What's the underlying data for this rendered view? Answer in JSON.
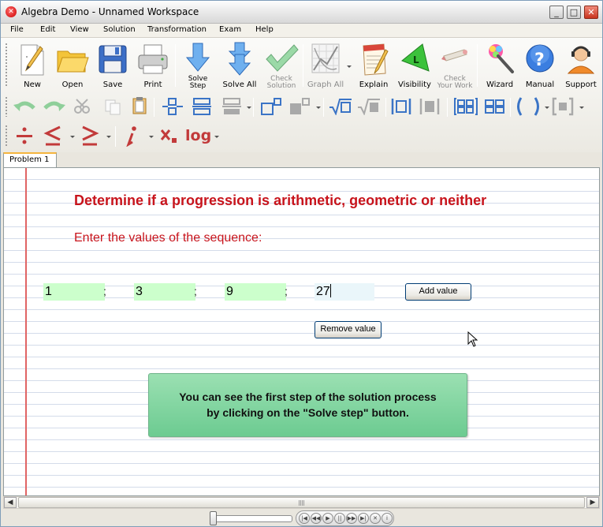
{
  "window": {
    "title": "Algebra Demo - Unnamed Workspace"
  },
  "menu": [
    "File",
    "Edit",
    "View",
    "Solution",
    "Transformation",
    "Exam",
    "Help"
  ],
  "toolbar_main": {
    "new": "New",
    "open": "Open",
    "save": "Save",
    "print": "Print",
    "solve_step": [
      "Solve",
      "Step"
    ],
    "solve_all": "Solve All",
    "check_solution": [
      "Check",
      "Solution"
    ],
    "graph_all": "Graph All",
    "explain": "Explain",
    "visibility": "Visibility",
    "check_your_work": [
      "Check",
      "Your Work"
    ],
    "wizard": "Wizard",
    "manual": "Manual",
    "support": "Support"
  },
  "toolbar_math": {
    "log": "log"
  },
  "tabs": [
    "Problem 1"
  ],
  "problem": {
    "heading": "Determine if a progression is arithmetic, geometric or neither",
    "prompt": "Enter the values of the sequence:",
    "values": [
      "1",
      "3",
      "9",
      "27"
    ],
    "separator": ";",
    "add_value": "Add value",
    "remove_value": "Remove value",
    "hint_lines": [
      "You can see the first step of the solution process",
      "by clicking on the \"Solve step\" button."
    ]
  },
  "colors": {
    "heading": "#c8141c",
    "field_green": "#ccffcc",
    "field_active": "#eaf6fa",
    "hint_green": "#6ccb91",
    "margin_line": "#e06464"
  },
  "icons": {
    "new": "new-document-icon",
    "open": "folder-icon",
    "save": "floppy-icon",
    "print": "printer-icon",
    "solve_step": "down-arrow-icon",
    "solve_all": "double-down-arrow-icon",
    "check_solution": "checkmark-icon",
    "graph_all": "graph-icon",
    "explain": "notepad-icon",
    "visibility": "visibility-triangle-icon",
    "check_your_work": "pencil-check-icon",
    "wizard": "magic-wand-icon",
    "manual": "help-icon",
    "support": "support-person-icon"
  }
}
